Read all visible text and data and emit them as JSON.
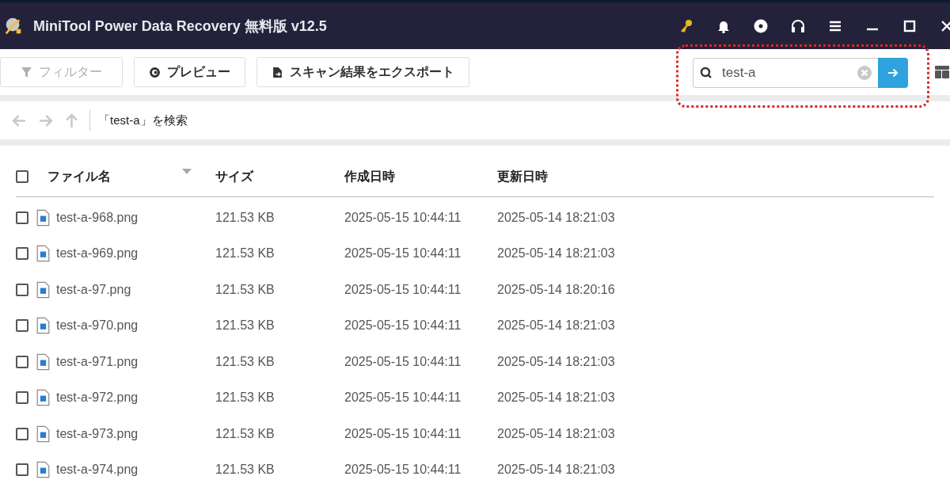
{
  "window": {
    "title": "MiniTool Power Data Recovery 無料版 v12.5"
  },
  "toolbar": {
    "buttons": [
      {
        "kind": "filter",
        "label": "フィルター",
        "disabled": true
      },
      {
        "kind": "preview",
        "label": "プレビュー",
        "disabled": false
      },
      {
        "kind": "export",
        "label": "スキャン結果をエクスポート",
        "disabled": false
      }
    ]
  },
  "search": {
    "value": "test-a",
    "highlighted": true
  },
  "nav": {
    "path": "「test-a」を検索"
  },
  "table": {
    "select_all_checked": false,
    "columns": [
      "ファイル名",
      "サイズ",
      "作成日時",
      "更新日時"
    ],
    "rows": [
      {
        "checked": false,
        "name": "test-a-968.png",
        "size": "121.53 KB",
        "created": "2025-05-15 10:44:11",
        "modified": "2025-05-14 18:21:03"
      },
      {
        "checked": false,
        "name": "test-a-969.png",
        "size": "121.53 KB",
        "created": "2025-05-15 10:44:11",
        "modified": "2025-05-14 18:21:03"
      },
      {
        "checked": false,
        "name": "test-a-97.png",
        "size": "121.53 KB",
        "created": "2025-05-15 10:44:11",
        "modified": "2025-05-14 18:20:16"
      },
      {
        "checked": false,
        "name": "test-a-970.png",
        "size": "121.53 KB",
        "created": "2025-05-15 10:44:11",
        "modified": "2025-05-14 18:21:03"
      },
      {
        "checked": false,
        "name": "test-a-971.png",
        "size": "121.53 KB",
        "created": "2025-05-15 10:44:11",
        "modified": "2025-05-14 18:21:03"
      },
      {
        "checked": false,
        "name": "test-a-972.png",
        "size": "121.53 KB",
        "created": "2025-05-15 10:44:11",
        "modified": "2025-05-14 18:21:03"
      },
      {
        "checked": false,
        "name": "test-a-973.png",
        "size": "121.53 KB",
        "created": "2025-05-15 10:44:11",
        "modified": "2025-05-14 18:21:03"
      },
      {
        "checked": false,
        "name": "test-a-974.png",
        "size": "121.53 KB",
        "created": "2025-05-15 10:44:11",
        "modified": "2025-05-14 18:21:03"
      }
    ]
  }
}
